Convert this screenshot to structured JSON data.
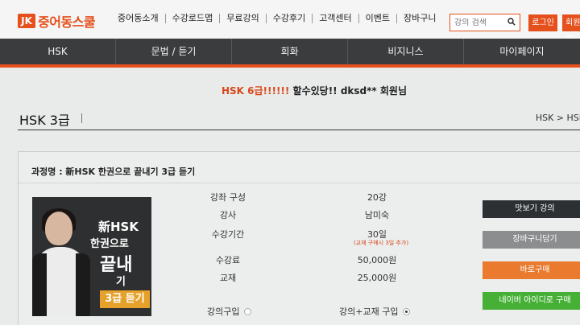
{
  "header": {
    "logo_mark": "JK",
    "logo_text": "중어동스쿨",
    "nav": [
      "중어동소개",
      "수강로드맵",
      "무료강의",
      "수강후기",
      "고객센터",
      "이벤트",
      "장바구니"
    ],
    "search_placeholder": "강의 검색",
    "login_label": "로그인",
    "join_label": "회원가입"
  },
  "main_nav": [
    "HSK",
    "문법 / 듣기",
    "회화",
    "비지니스",
    "마이페이지"
  ],
  "promo": {
    "highlight": "HSK 6급!!!!!!",
    "text": " 할수있당!! dksd** 회원님"
  },
  "page": {
    "title": "HSK 3급",
    "breadcrumb": "HSK > HSK"
  },
  "course": {
    "name": "과정명 : 新HSK 한권으로 끝내기 3급 듣기",
    "thumbnail": {
      "line1": "新HSK",
      "line2": "한권으로",
      "line3": "끝내",
      "line4": "기",
      "badge": "3급 듣기"
    },
    "info": [
      {
        "label": "강좌 구성",
        "value": "20강"
      },
      {
        "label": "강사",
        "value": "남미숙"
      },
      {
        "label": "수강기간",
        "value": "30일"
      },
      {
        "label": "수강료",
        "value": "50,000원"
      },
      {
        "label": "교재",
        "value": "25,000원"
      }
    ],
    "period_note": "(교재 구매시 3일 추가)",
    "options": {
      "lecture_only": "강의구입",
      "lecture_book": "강의+교재 구입"
    },
    "buttons": {
      "preview": "맛보기 강의",
      "cart": "장바구니담기",
      "buy_now": "바로구매",
      "naver": "네이버 아이디로 구매"
    }
  },
  "colors": {
    "accent": "#e5501d",
    "nav_bg": "#3a3c3e",
    "preview_btn": "#2d3033",
    "cart_btn": "#8c8d8e",
    "buy_btn": "#e97a2e",
    "naver_btn": "#45b035"
  }
}
